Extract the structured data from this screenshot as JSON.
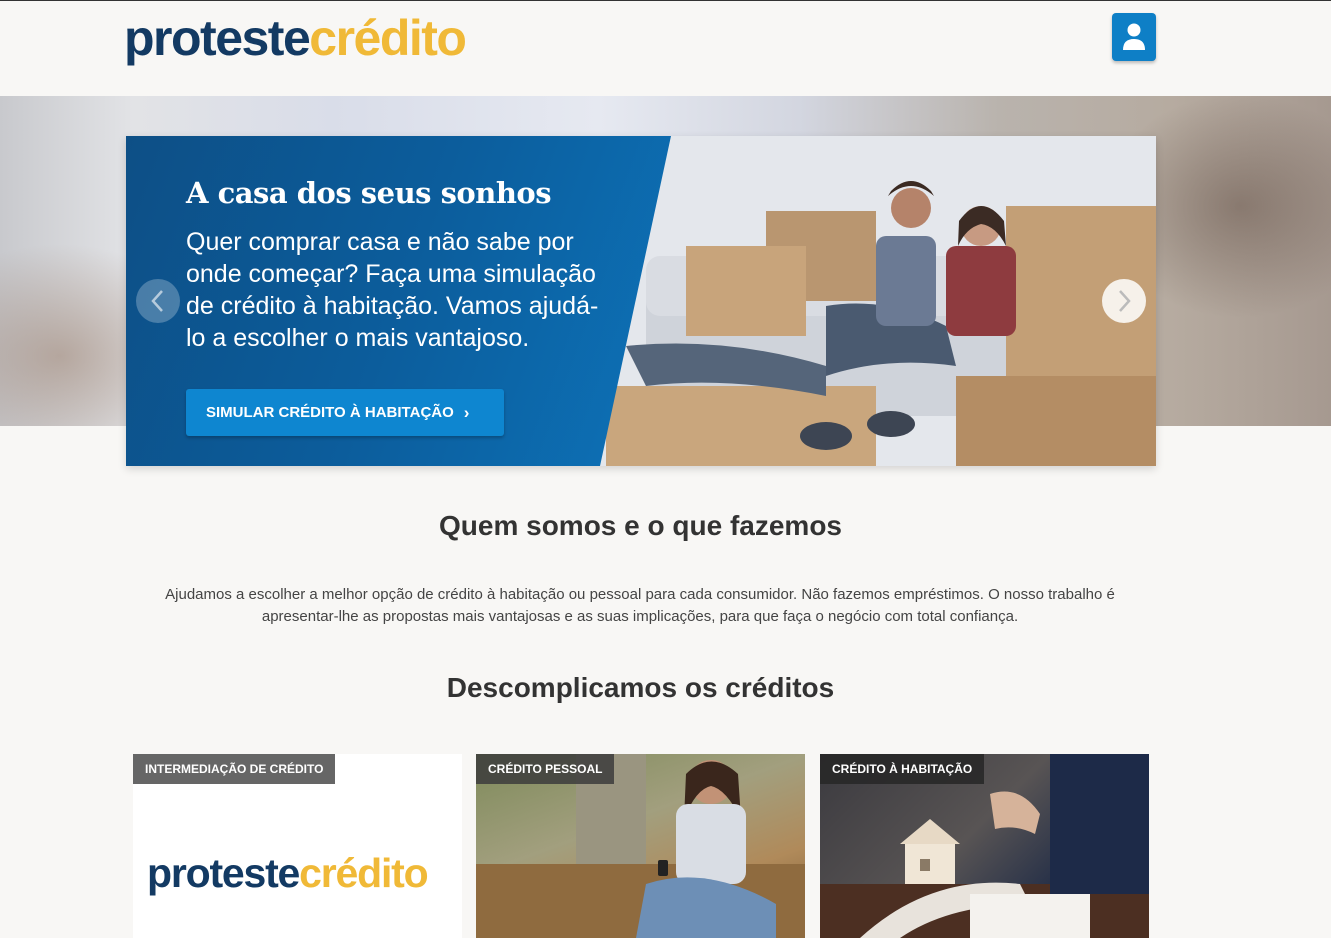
{
  "header": {
    "logo_part1": "proteste",
    "logo_part2": "crédito",
    "user_button": "user-icon"
  },
  "hero": {
    "title": "A casa dos seus sonhos",
    "text": "Quer comprar casa e não sabe por onde começar? Faça uma simulação de crédito à habitação. Vamos ajudá-lo a escolher o mais vantajoso.",
    "cta_label": "SIMULAR CRÉDITO À HABITAÇÃO",
    "cta_icon": "chevron-right-icon",
    "prev_icon": "chevron-left-icon",
    "next_icon": "chevron-right-icon"
  },
  "about": {
    "title": "Quem somos e o que fazemos",
    "text": "Ajudamos a escolher a melhor opção de crédito à habitação ou pessoal para cada consumidor. Não fazemos empréstimos. O nosso trabalho é apresentar-lhe as propostas mais vantajosas e as suas implicações, para que faça o negócio com total confiança."
  },
  "credits": {
    "title": "Descomplicamos os créditos",
    "cards": [
      {
        "tag": "INTERMEDIAÇÃO DE CRÉDITO",
        "logo_part1": "proteste",
        "logo_part2": "crédito"
      },
      {
        "tag": "CRÉDITO PESSOAL"
      },
      {
        "tag": "CRÉDITO À HABITAÇÃO"
      }
    ]
  },
  "colors": {
    "brand_navy": "#133a63",
    "brand_yellow": "#f0b937",
    "accent_blue": "#0e86d0"
  }
}
